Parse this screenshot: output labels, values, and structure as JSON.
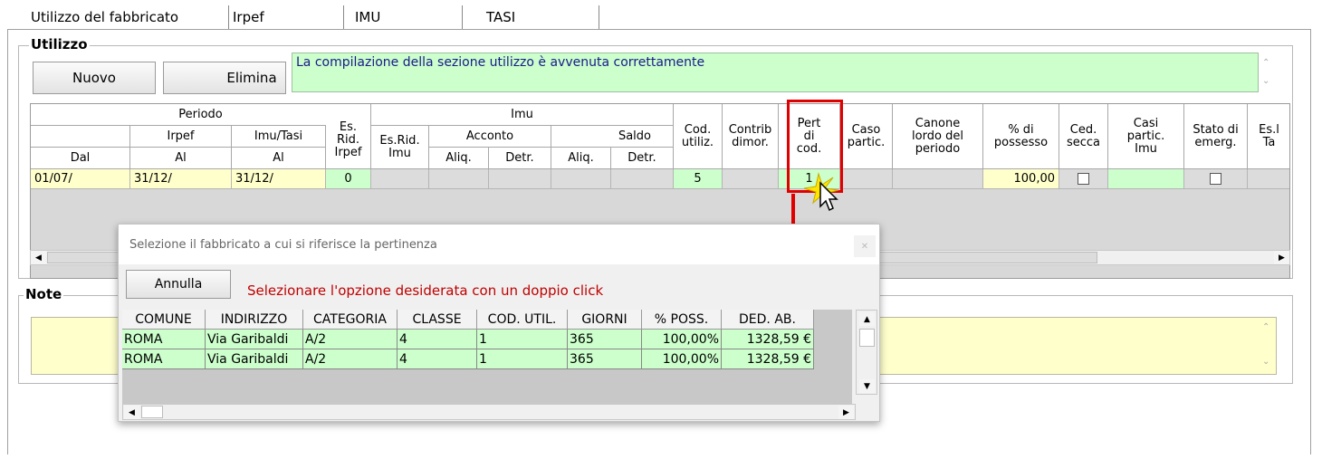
{
  "tabs": [
    {
      "label": "Utilizzo del fabbricato"
    },
    {
      "label": "Irpef"
    },
    {
      "label": "IMU"
    },
    {
      "label": "TASI"
    }
  ],
  "utilizzo": {
    "title": "Utilizzo",
    "new_label": "Nuovo",
    "delete_label": "Elimina",
    "status_message": "La compilazione della sezione utilizzo è avvenuta correttamente"
  },
  "grid": {
    "headers": {
      "periodo": "Periodo",
      "irpef": "Irpef",
      "imu_tasi": "Imu/Tasi",
      "dal": "Dal",
      "al1": "Al",
      "al2": "Al",
      "es_rid_irpef": "Es.\nRid.\nIrpef",
      "imu": "Imu",
      "es_rid_imu": "Es.Rid.\nImu",
      "acconto": "Acconto",
      "saldo": "Saldo",
      "aliq1": "Aliq.",
      "detr1": "Detr.",
      "aliq2": "Aliq.",
      "detr2": "Detr.",
      "cod_utiliz": "Cod.\nutiliz.",
      "contrib_dimor": "Contrib\ndimor.",
      "pert_di_cod": "Pert\ndi\ncod.",
      "caso_partic": "Caso\npartic.",
      "canone": "Canone\nlordo del\nperiodo",
      "possesso": "% di\npossesso",
      "ced_secca": "Ced.\nsecca",
      "casi_partic_imu": "Casi\npartic.\nImu",
      "stato_emerg": "Stato di\nemerg.",
      "es_ta": "Es.l\nTa"
    },
    "row": {
      "dal": "01/07/",
      "al_irpef": "31/12/",
      "al_imu": "31/12/",
      "es_rid_irpef": "0",
      "cod_utiliz": "5",
      "pert_di_cod": "1",
      "possesso": "100,00"
    }
  },
  "note": {
    "title": "Note"
  },
  "popup": {
    "title": "Selezione il fabbricato a cui si riferisce la pertinenza",
    "cancel_label": "Annulla",
    "instruction": "Selezionare l'opzione desiderata con un doppio click",
    "columns": [
      "COMUNE",
      "INDIRIZZO",
      "CATEGORIA",
      "CLASSE",
      "COD. UTIL.",
      "GIORNI",
      "% POSS.",
      "DED. AB."
    ],
    "rows": [
      [
        "ROMA",
        "Via Garibaldi",
        "A/2",
        "4",
        "1",
        "365",
        "100,00%",
        "1328,59 €"
      ],
      [
        "ROMA",
        "Via Garibaldi",
        "A/2",
        "4",
        "1",
        "365",
        "100,00%",
        "1328,59 €"
      ]
    ]
  },
  "colors": {
    "accent_green": "#ccffcc",
    "field_yellow": "#ffffcc",
    "highlight_red": "#e00000",
    "message_text": "#1a1a8a"
  }
}
